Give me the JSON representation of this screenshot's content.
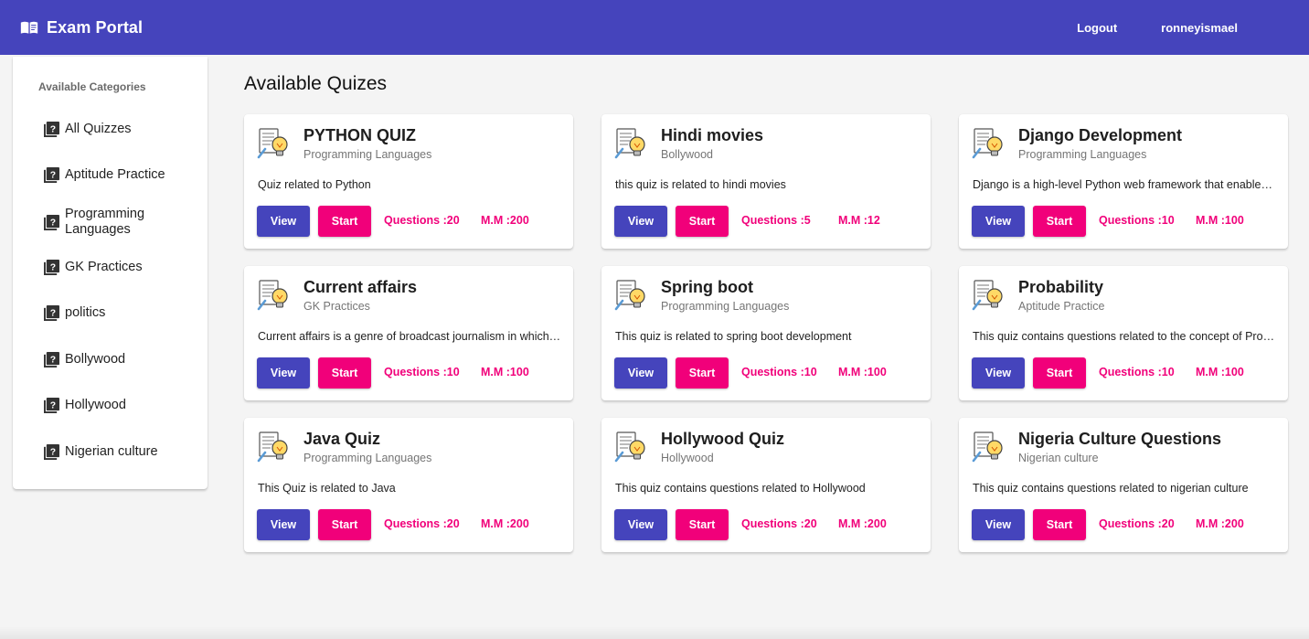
{
  "app": {
    "title": "Exam Portal",
    "nav": {
      "logout_label": "Logout",
      "username": "ronneyismael"
    },
    "colors": {
      "primary": "#4544bc",
      "accent": "#f1007a"
    }
  },
  "sidebar": {
    "header": "Available Categories",
    "items": [
      {
        "label": "All Quizzes",
        "icon": "quiz-icon"
      },
      {
        "label": "Aptitude Practice",
        "icon": "quiz-icon"
      },
      {
        "label": "Programming Languages",
        "icon": "quiz-icon"
      },
      {
        "label": "GK Practices",
        "icon": "quiz-icon"
      },
      {
        "label": "politics",
        "icon": "quiz-icon"
      },
      {
        "label": "Bollywood",
        "icon": "quiz-icon"
      },
      {
        "label": "Hollywood",
        "icon": "quiz-icon"
      },
      {
        "label": "Nigerian culture",
        "icon": "quiz-icon"
      }
    ]
  },
  "main": {
    "title": "Available Quizes",
    "cards": [
      {
        "title": "PYTHON QUIZ",
        "category": "Programming Languages",
        "description": "Quiz related to Python",
        "view_label": "View",
        "start_label": "Start",
        "questions": "Questions :20",
        "max_marks": "M.M :200"
      },
      {
        "title": "Hindi movies",
        "category": "Bollywood",
        "description": "this quiz is related to hindi movies",
        "view_label": "View",
        "start_label": "Start",
        "questions": "Questions :5",
        "max_marks": "M.M :12"
      },
      {
        "title": "Django Development",
        "category": "Programming Languages",
        "description": "Django is a high-level Python web framework that enables rapid development of secure and maintainable websites",
        "view_label": "View",
        "start_label": "Start",
        "questions": "Questions :10",
        "max_marks": "M.M :100"
      },
      {
        "title": "Current affairs",
        "category": "GK Practices",
        "description": "Current affairs is a genre of broadcast journalism in which the emphasis is on detailed analysis",
        "view_label": "View",
        "start_label": "Start",
        "questions": "Questions :10",
        "max_marks": "M.M :100"
      },
      {
        "title": "Spring boot",
        "category": "Programming Languages",
        "description": "This quiz is related to spring boot development",
        "view_label": "View",
        "start_label": "Start",
        "questions": "Questions :10",
        "max_marks": "M.M :100"
      },
      {
        "title": "Probability",
        "category": "Aptitude Practice",
        "description": "This quiz contains questions related to the concept of Probability",
        "view_label": "View",
        "start_label": "Start",
        "questions": "Questions :10",
        "max_marks": "M.M :100"
      },
      {
        "title": "Java Quiz",
        "category": "Programming Languages",
        "description": "This Quiz is related to Java",
        "view_label": "View",
        "start_label": "Start",
        "questions": "Questions :20",
        "max_marks": "M.M :200"
      },
      {
        "title": "Hollywood Quiz",
        "category": "Hollywood",
        "description": "This quiz contains questions related to Hollywood",
        "view_label": "View",
        "start_label": "Start",
        "questions": "Questions :20",
        "max_marks": "M.M :200"
      },
      {
        "title": "Nigeria Culture Questions",
        "category": "Nigerian culture",
        "description": "This quiz contains questions related to nigerian culture",
        "view_label": "View",
        "start_label": "Start",
        "questions": "Questions :20",
        "max_marks": "M.M :200"
      }
    ]
  }
}
